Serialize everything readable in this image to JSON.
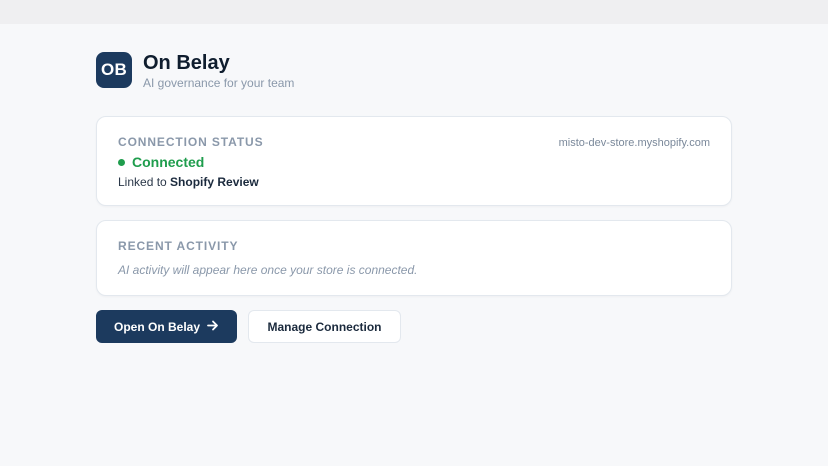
{
  "brand": {
    "logo_text": "OB",
    "title": "On Belay",
    "subtitle": "AI governance for your team"
  },
  "connection": {
    "label": "CONNECTION STATUS",
    "domain": "misto-dev-store.myshopify.com",
    "status": "Connected",
    "status_color": "#1f9d4d",
    "linked_prefix": "Linked to",
    "linked_name": "Shopify Review"
  },
  "activity": {
    "label": "RECENT ACTIVITY",
    "empty_text": "AI activity will appear here once your store is connected."
  },
  "actions": {
    "primary_label": "Open On Belay",
    "primary_icon": "arrow-right-icon",
    "secondary_label": "Manage Connection"
  },
  "colors": {
    "accent": "#1c3a5e",
    "background": "#f7f8fa"
  }
}
